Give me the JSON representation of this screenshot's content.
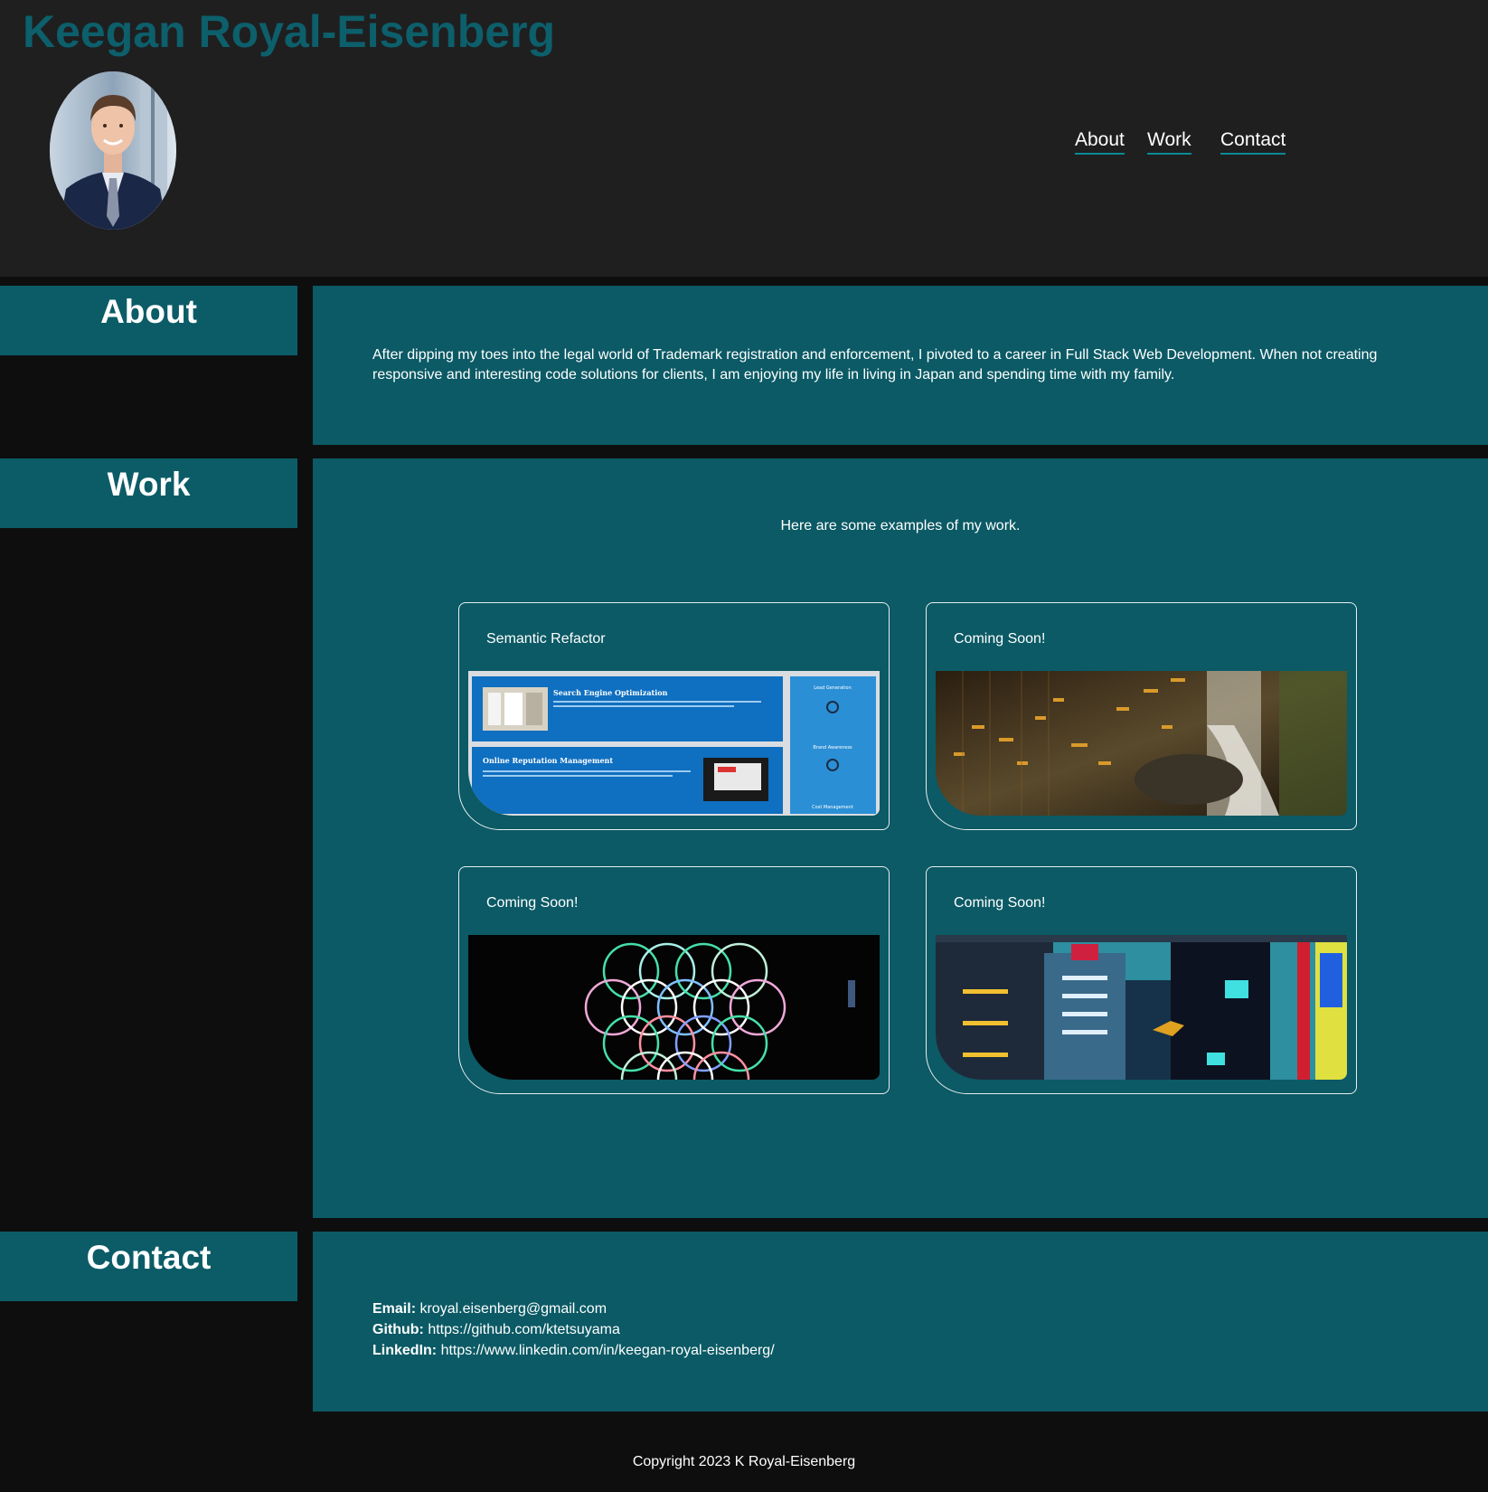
{
  "header": {
    "site_title": "Keegan Royal-Eisenberg",
    "nav": [
      {
        "label": "About"
      },
      {
        "label": "Work"
      },
      {
        "label": "Contact"
      }
    ]
  },
  "about": {
    "heading": "About",
    "text": "After dipping my toes into the legal world of Trademark registration and enforcement, I pivoted to a career in Full Stack Web Development. When not creating responsive and interesting code solutions for clients, I am enjoying my life in living in Japan and spending time with my family."
  },
  "work": {
    "heading": "Work",
    "intro": "Here are some examples of my work.",
    "cards": [
      {
        "title": "Semantic Refactor",
        "preview": {
          "seo_title": "Search Engine Optimization",
          "orm_title": "Online Reputation Management",
          "side_1": "Lead Generation",
          "side_2": "Brand Awareness",
          "side_3": "Cost Management"
        }
      },
      {
        "title": "Coming Soon!"
      },
      {
        "title": "Coming Soon!"
      },
      {
        "title": "Coming Soon!"
      }
    ]
  },
  "contact": {
    "heading": "Contact",
    "email_label": "Email:",
    "email": "kroyal.eisenberg@gmail.com",
    "github_label": "Github:",
    "github": "https://github.com/ktetsuyama",
    "linkedin_label": "LinkedIn:",
    "linkedin": "https://www.linkedin.com/in/keegan-royal-eisenberg/"
  },
  "footer": {
    "copyright": "Copyright 2023 K Royal-Eisenberg"
  },
  "colors": {
    "title": "#0c5f6b",
    "panel": "#0b5a65",
    "header_bg": "#1f1f20",
    "page_bg": "#0e0e0f"
  }
}
